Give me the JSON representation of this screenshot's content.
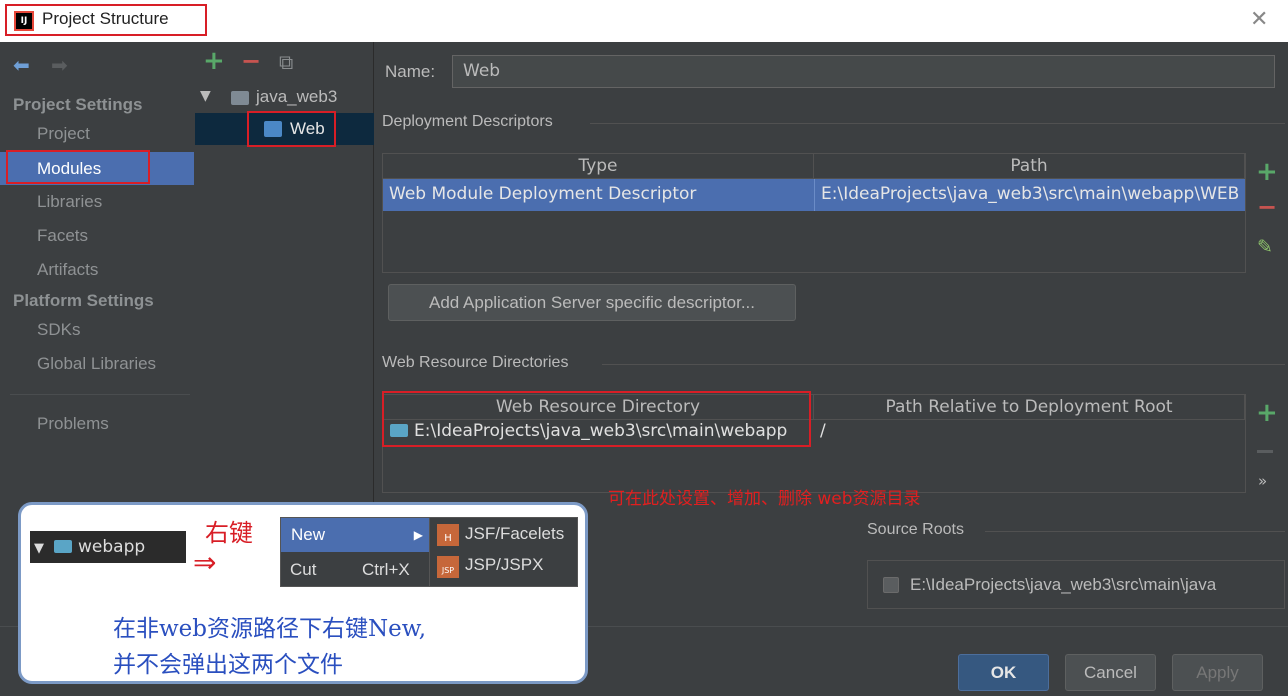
{
  "window": {
    "title": "Project Structure",
    "close": "✕"
  },
  "nav": {
    "back": "⬅",
    "forward": "➡",
    "project_settings": "Project Settings",
    "items": [
      "Project",
      "Modules",
      "Libraries",
      "Facets",
      "Artifacts"
    ],
    "platform_settings": "Platform Settings",
    "platform_items": [
      "SDKs",
      "Global Libraries"
    ],
    "problems": "Problems"
  },
  "tree": {
    "toolbar": {
      "add": "+",
      "remove": "−",
      "copy": "⧉"
    },
    "root": "java_web3",
    "child": "Web"
  },
  "module": {
    "name_label": "Name:",
    "name_value": "Web",
    "deployment_descriptors": "Deployment Descriptors",
    "dd_columns": [
      "Type",
      "Path"
    ],
    "dd_row": {
      "type": "Web Module Deployment Descriptor",
      "path": "E:\\IdeaProjects\\java_web3\\src\\main\\webapp\\WEB"
    },
    "add_server_btn": "Add Application Server specific descriptor...",
    "web_resource_dirs": "Web Resource Directories",
    "wr_columns": [
      "Web Resource Directory",
      "Path Relative to Deployment Root"
    ],
    "wr_row": {
      "dir": "E:\\IdeaProjects\\java_web3\\src\\main\\webapp",
      "rel": "/"
    },
    "annotation": "可在此处设置、增加、删除 web资源目录",
    "source_roots": "Source Roots",
    "source_root_path": "E:\\IdeaProjects\\java_web3\\src\\main\\java",
    "more": "»"
  },
  "buttons": {
    "ok": "OK",
    "cancel": "Cancel",
    "apply": "Apply"
  },
  "overlay": {
    "tree_item": "webapp",
    "right_click": "右键",
    "menu_new": "New",
    "menu_cut": "Cut",
    "menu_cut_shortcut": "Ctrl+X",
    "submenu": [
      "JSF/Facelets",
      "JSP/JSPX"
    ],
    "note_line1": "在非web资源路径下右键New,",
    "note_line2": "并不会弹出这两个文件"
  },
  "colors": {
    "accent": "#4b6eaf",
    "highlight": "#d81e26",
    "add": "#59a869",
    "remove": "#c75450"
  }
}
